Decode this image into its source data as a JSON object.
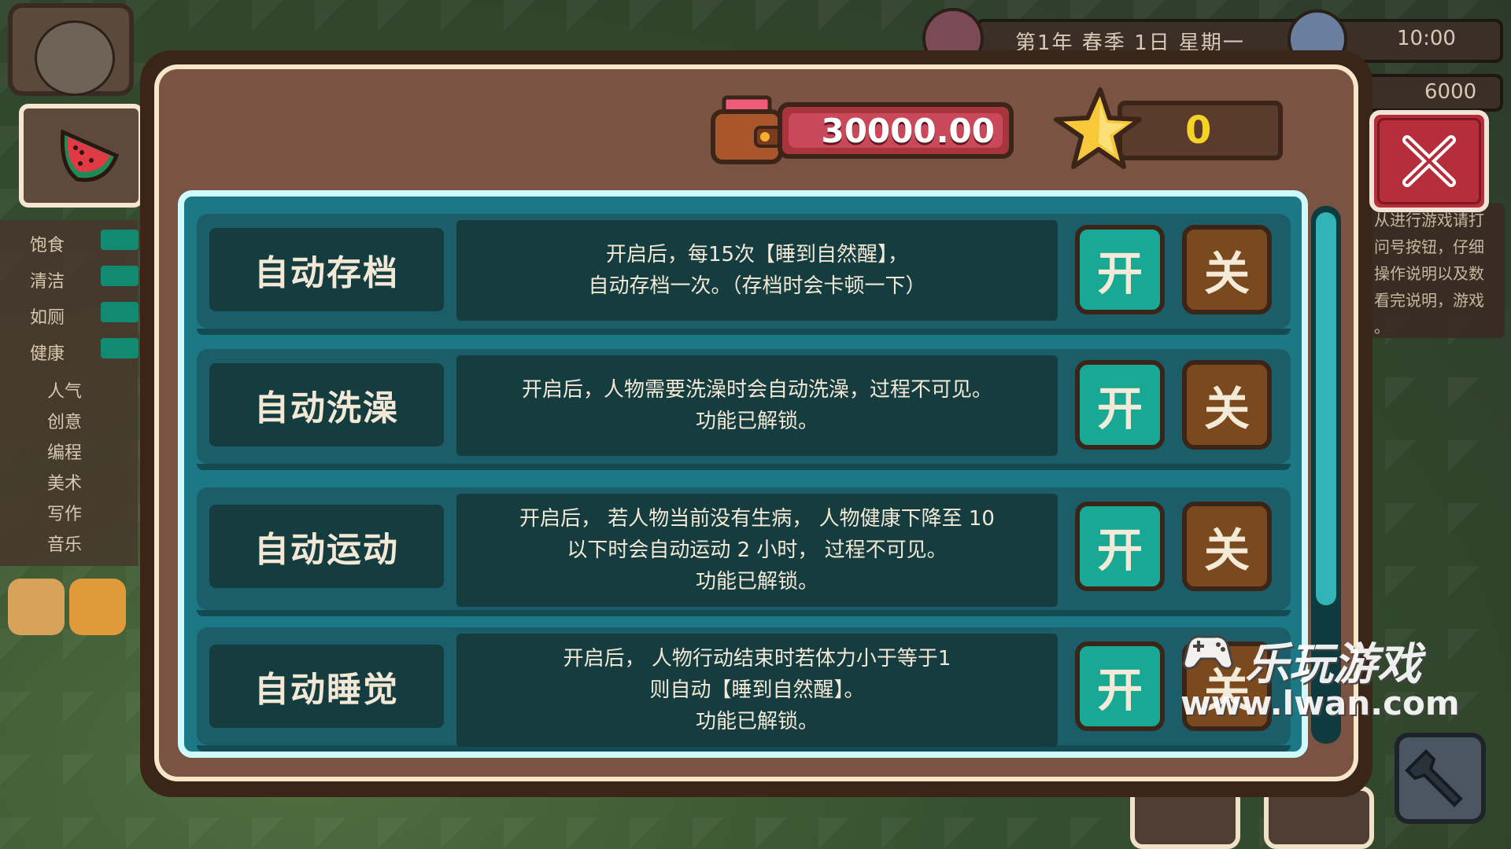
{
  "hud": {
    "date": "第1年  春季  1日    星期一",
    "time": "10:00",
    "secondary_money": "6000",
    "stats": [
      "饱食",
      "清洁",
      "如厕",
      "健康"
    ],
    "skills": [
      "人气",
      "创意",
      "编程",
      "美术",
      "写作",
      "音乐"
    ],
    "tip_lines": [
      "从进行游戏请打",
      "问号按钮，仔细",
      "操作说明以及数",
      "看完说明，游戏",
      "。"
    ]
  },
  "dialog": {
    "money": "30000.00",
    "stars": "0",
    "items": [
      {
        "title": "自动存档",
        "desc": [
          "开启后，每15次【睡到自然醒】，",
          "自动存档一次。（存档时会卡顿一下）"
        ],
        "on": "开",
        "off": "关"
      },
      {
        "title": "自动洗澡",
        "desc": [
          "开启后，人物需要洗澡时会自动洗澡，过程不可见。",
          "功能已解锁。"
        ],
        "on": "开",
        "off": "关"
      },
      {
        "title": "自动运动",
        "desc": [
          "开启后， 若人物当前没有生病， 人物健康下降至 10",
          "以下时会自动运动 2 小时， 过程不可见。",
          "功能已解锁。"
        ],
        "on": "开",
        "off": "关"
      },
      {
        "title": "自动睡觉",
        "desc": [
          "开启后， 人物行动结束时若体力小于等于1",
          "则自动【睡到自然醒】。",
          "功能已解锁。"
        ],
        "on": "开",
        "off": "关"
      }
    ]
  },
  "watermark": {
    "name": "乐玩游戏",
    "url": "www.lwan.com"
  },
  "colors": {
    "on": "#19a893",
    "off": "#7a4a1e",
    "close": "#b52e3a",
    "money_bar": "#c9485a",
    "star": "#f5d226"
  }
}
